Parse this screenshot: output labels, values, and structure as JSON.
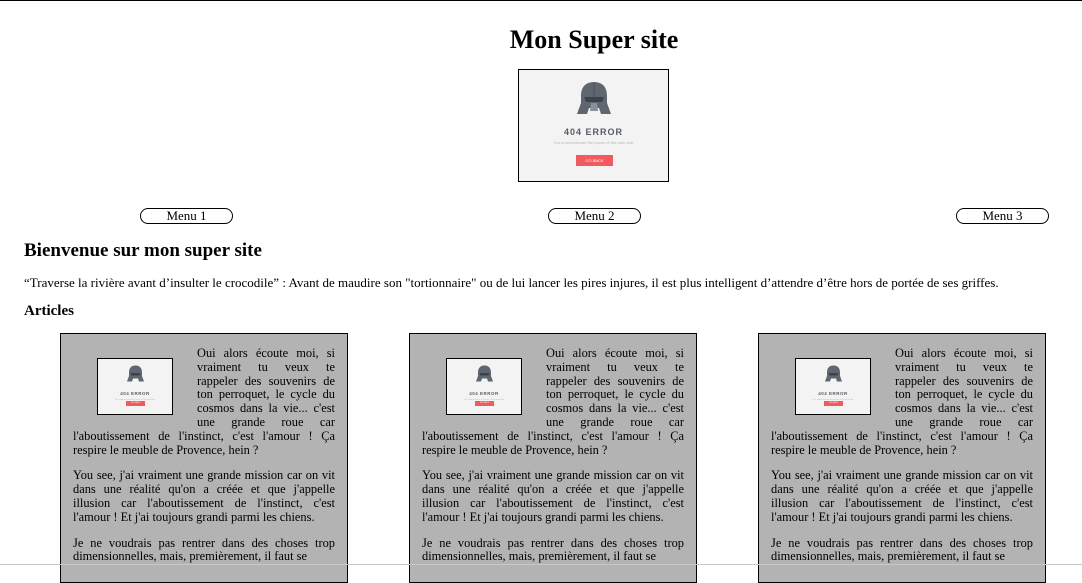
{
  "header": {
    "site_title": "Mon Super site",
    "hero_image": {
      "error_code": "404 ERROR",
      "subtitle": "You underestimate the power of the dark side",
      "button_label": "GO BACK"
    }
  },
  "nav": {
    "menu": [
      "Menu 1",
      "Menu 2",
      "Menu 3"
    ]
  },
  "main": {
    "welcome_title": "Bienvenue sur mon super site",
    "quote": "“Traverse la rivière avant d’insulter le crocodile” : Avant de maudire son \"tortionnaire\" ou de lui lancer les pires injures, il est plus intelligent d’attendre d’être hors de portée de ses griffes.",
    "articles_title": "Articles",
    "articles": [
      {
        "p1": "Oui alors écoute moi, si vraiment tu veux te rappeler des souvenirs de ton perroquet, le cycle du cosmos dans la vie... c'est une grande roue car l'aboutissement de l'instinct, c'est l'amour ! Ça respire le meuble de Provence, hein ?",
        "p2": "You see, j'ai vraiment une grande mission car on vit dans une réalité qu'on a créée et que j'appelle illusion car l'aboutissement de l'instinct, c'est l'amour ! Et j'ai toujours grandi parmi les chiens.",
        "p3": "Je ne voudrais pas rentrer dans des choses trop dimensionnelles, mais, premièrement, il faut se"
      },
      {
        "p1": "Oui alors écoute moi, si vraiment tu veux te rappeler des souvenirs de ton perroquet, le cycle du cosmos dans la vie... c'est une grande roue car l'aboutissement de l'instinct, c'est l'amour ! Ça respire le meuble de Provence, hein ?",
        "p2": "You see, j'ai vraiment une grande mission car on vit dans une réalité qu'on a créée et que j'appelle illusion car l'aboutissement de l'instinct, c'est l'amour ! Et j'ai toujours grandi parmi les chiens.",
        "p3": "Je ne voudrais pas rentrer dans des choses trop dimensionnelles, mais, premièrement, il faut se"
      },
      {
        "p1": "Oui alors écoute moi, si vraiment tu veux te rappeler des souvenirs de ton perroquet, le cycle du cosmos dans la vie... c'est une grande roue car l'aboutissement de l'instinct, c'est l'amour ! Ça respire le meuble de Provence, hein ?",
        "p2": "You see, j'ai vraiment une grande mission car on vit dans une réalité qu'on a créée et que j'appelle illusion car l'aboutissement de l'instinct, c'est l'amour ! Et j'ai toujours grandi parmi les chiens.",
        "p3": "Je ne voudrais pas rentrer dans des choses trop dimensionnelles, mais, premièrement, il faut se"
      }
    ]
  },
  "colors": {
    "article_bg": "#b3b3b3",
    "error_button": "#f25a62",
    "helmet": "#5f6670"
  },
  "icons": {
    "hero": "darth-vader-helmet-icon"
  }
}
